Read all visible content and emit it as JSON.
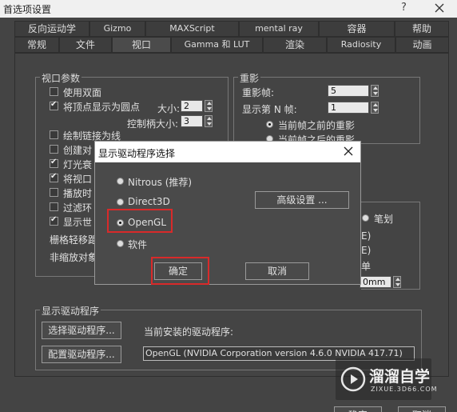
{
  "window": {
    "title": "首选项设置",
    "help": "?"
  },
  "tabs_row1": [
    "反向运动学",
    "Gizmo",
    "MAXScript",
    "mental ray",
    "容器",
    "帮助"
  ],
  "tabs_row2": [
    "常规",
    "文件",
    "视口",
    "Gamma 和 LUT",
    "渲染",
    "Radiosity",
    "动画"
  ],
  "viewport_params": {
    "label": "视口参数",
    "items": [
      {
        "label": "使用双面",
        "checked": false
      },
      {
        "label": "将顶点显示为圆点",
        "checked": true
      },
      {
        "label": "绘制链接为线",
        "checked": false
      },
      {
        "label": "创建对",
        "checked": false
      },
      {
        "label": "灯光衰",
        "checked": true
      },
      {
        "label": "将视口",
        "checked": true
      },
      {
        "label": "播放时",
        "checked": false
      },
      {
        "label": "过滤环",
        "checked": false
      },
      {
        "label": "显示世",
        "checked": true
      }
    ],
    "size_label": "大小:",
    "size_value": "2",
    "handle_size_label": "控制柄大小:",
    "handle_size_value": "3",
    "grid_nudge": "栅格轻移距",
    "non_scaling": "非缩放对象"
  },
  "ghosting": {
    "label": "重影",
    "frames_label": "重影帧:",
    "frames_value": "5",
    "nth_label": "显示第 N 帧:",
    "nth_value": "1",
    "before_label": "当前帧之前的重影",
    "after_label": "当前帧之后的重影"
  },
  "right_fragments": {
    "brush": "笔划",
    "a": "E)",
    "b": "E)",
    "c": "单",
    "value": "0mm"
  },
  "driver": {
    "label": "显示驱动程序",
    "choose_btn": "选择驱动程序...",
    "config_btn": "配置驱动程序...",
    "current_label": "当前安装的驱动程序:",
    "current_value": "OpenGL (NVIDIA Corporation version 4.6.0 NVIDIA 417.71)"
  },
  "bottom_buttons": {
    "ok": "确定",
    "cancel": "取消"
  },
  "modal": {
    "title": "显示驱动程序选择",
    "options": [
      {
        "label": "Nitrous (推荐)",
        "selected": false
      },
      {
        "label": "Direct3D",
        "selected": false
      },
      {
        "label": "OpenGL",
        "selected": true
      },
      {
        "label": "软件",
        "selected": false
      }
    ],
    "advanced_btn": "高级设置 ...",
    "ok_btn": "确定",
    "cancel_btn": "取消"
  },
  "watermark": {
    "brand": "溜溜自学",
    "url": "ZIXUE.3D66.COM"
  },
  "colors": {
    "highlight": "#d82a2a",
    "background": "#444444"
  }
}
